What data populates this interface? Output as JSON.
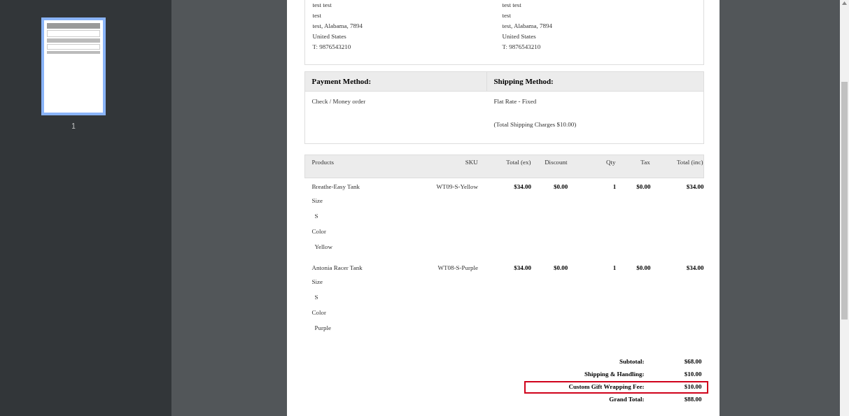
{
  "sidebar": {
    "thumbnails": [
      {
        "page_label": "1",
        "selected": true
      }
    ]
  },
  "address": {
    "columns": [
      {
        "lines": [
          "test test",
          "test",
          "test, Alabama, 7894",
          "United States",
          "T: 9876543210"
        ]
      },
      {
        "lines": [
          "test test",
          "test",
          "test, Alabama, 7894",
          "United States",
          "T: 9876543210"
        ]
      }
    ]
  },
  "methods": {
    "headers": [
      "Payment Method:",
      "Shipping Method:"
    ],
    "payment": [
      "Check / Money order"
    ],
    "shipping": [
      "Flat Rate - Fixed",
      "(Total Shipping Charges $10.00)"
    ]
  },
  "items": {
    "columns": [
      "Products",
      "SKU",
      "Total (ex)",
      "Discount",
      "Qty",
      "Tax",
      "Total (inc)"
    ],
    "rows": [
      {
        "name": "Breathe-Easy Tank",
        "sku": "WT09-S-Yellow",
        "total_ex": "$34.00",
        "discount": "$0.00",
        "qty": "1",
        "tax": "$0.00",
        "total_inc": "$34.00",
        "options": [
          {
            "label": "Size",
            "value": "S"
          },
          {
            "label": "Color",
            "value": "Yellow"
          }
        ]
      },
      {
        "name": "Antonia Racer Tank",
        "sku": "WT08-S-Purple",
        "total_ex": "$34.00",
        "discount": "$0.00",
        "qty": "1",
        "tax": "$0.00",
        "total_inc": "$34.00",
        "options": [
          {
            "label": "Size",
            "value": "S"
          },
          {
            "label": "Color",
            "value": "Purple"
          }
        ]
      }
    ]
  },
  "totals": [
    {
      "label": "Subtotal:",
      "value": "$68.00",
      "highlighted": false
    },
    {
      "label": "Shipping & Handling:",
      "value": "$10.00",
      "highlighted": false
    },
    {
      "label": "Custom Gift Wrapping Fee:",
      "value": "$10.00",
      "highlighted": true
    },
    {
      "label": "Grand Total:",
      "value": "$88.00",
      "highlighted": false
    }
  ]
}
